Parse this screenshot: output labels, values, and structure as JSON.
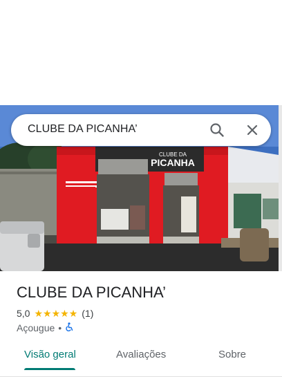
{
  "search": {
    "query": "CLUBE DA PICANHA’"
  },
  "icons": {
    "search": "search-icon",
    "close": "close-icon",
    "wheelchair": "wheelchair-icon"
  },
  "place": {
    "title": "CLUBE DA PICANHA’",
    "rating": "5,0",
    "stars": 5,
    "review_count": "(1)",
    "category": "Açougue",
    "separator": "•"
  },
  "photo_sign": {
    "brand_top": "CLUBE DA",
    "brand_main": "PICANHA"
  },
  "tabs": [
    {
      "label": "Visão geral",
      "active": true
    },
    {
      "label": "Avaliações",
      "active": false
    },
    {
      "label": "Sobre",
      "active": false
    }
  ],
  "colors": {
    "accent": "#017b74",
    "star": "#f4b400",
    "storefront": "#e01b22"
  }
}
